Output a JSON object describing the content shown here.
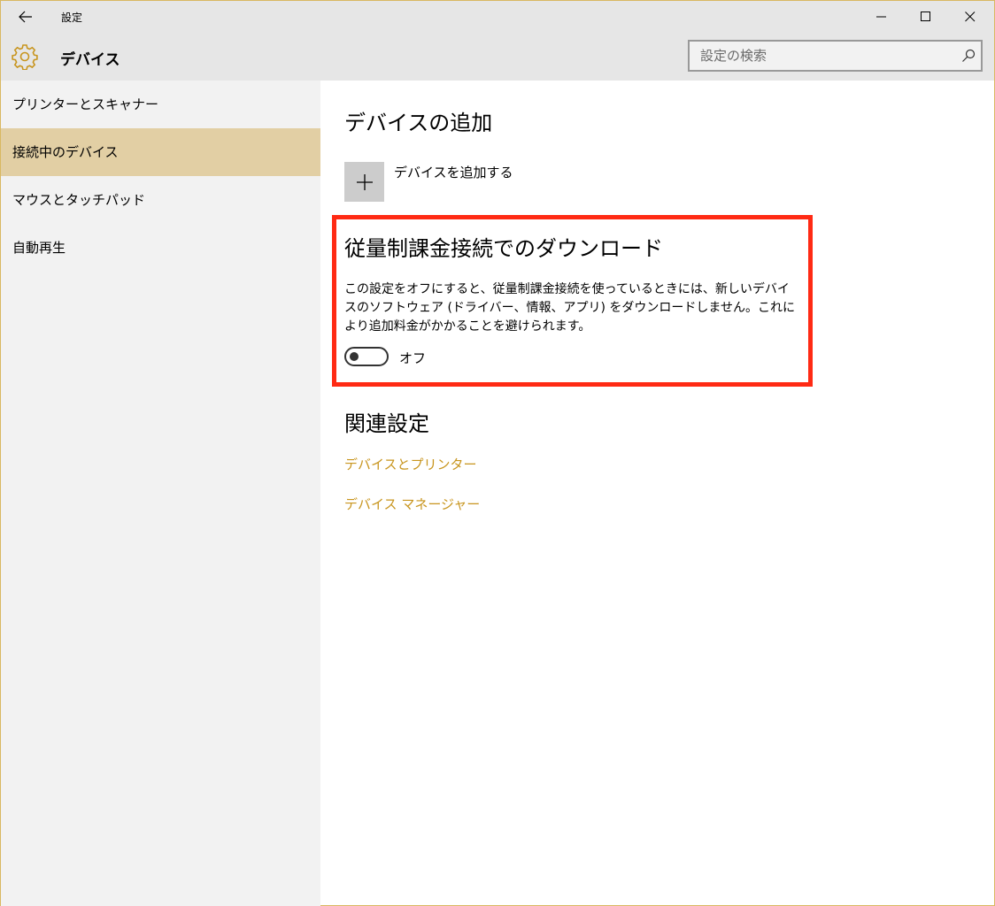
{
  "window": {
    "title": "設定"
  },
  "header": {
    "title": "デバイス",
    "search_placeholder": "設定の検索"
  },
  "sidebar": {
    "items": [
      {
        "label": "プリンターとスキャナー",
        "active": false
      },
      {
        "label": "接続中のデバイス",
        "active": true
      },
      {
        "label": "マウスとタッチパッド",
        "active": false
      },
      {
        "label": "自動再生",
        "active": false
      }
    ]
  },
  "main": {
    "add_section_title": "デバイスの追加",
    "add_device_label": "デバイスを追加する",
    "metered_title": "従量制課金接続でのダウンロード",
    "metered_description": "この設定をオフにすると、従量制課金接続を使っているときには、新しいデバイスのソフトウェア (ドライバー、情報、アプリ) をダウンロードしません。これにより追加料金がかかることを避けられます。",
    "toggle_label": "オフ",
    "related_title": "関連設定",
    "related_links": [
      "デバイスとプリンター",
      "デバイス マネージャー"
    ]
  },
  "colors": {
    "accent": "#c8951e",
    "sidebar_active": "#e2cfa4",
    "highlight_box": "#ff2a14",
    "titlebar": "#e6e6e6"
  }
}
